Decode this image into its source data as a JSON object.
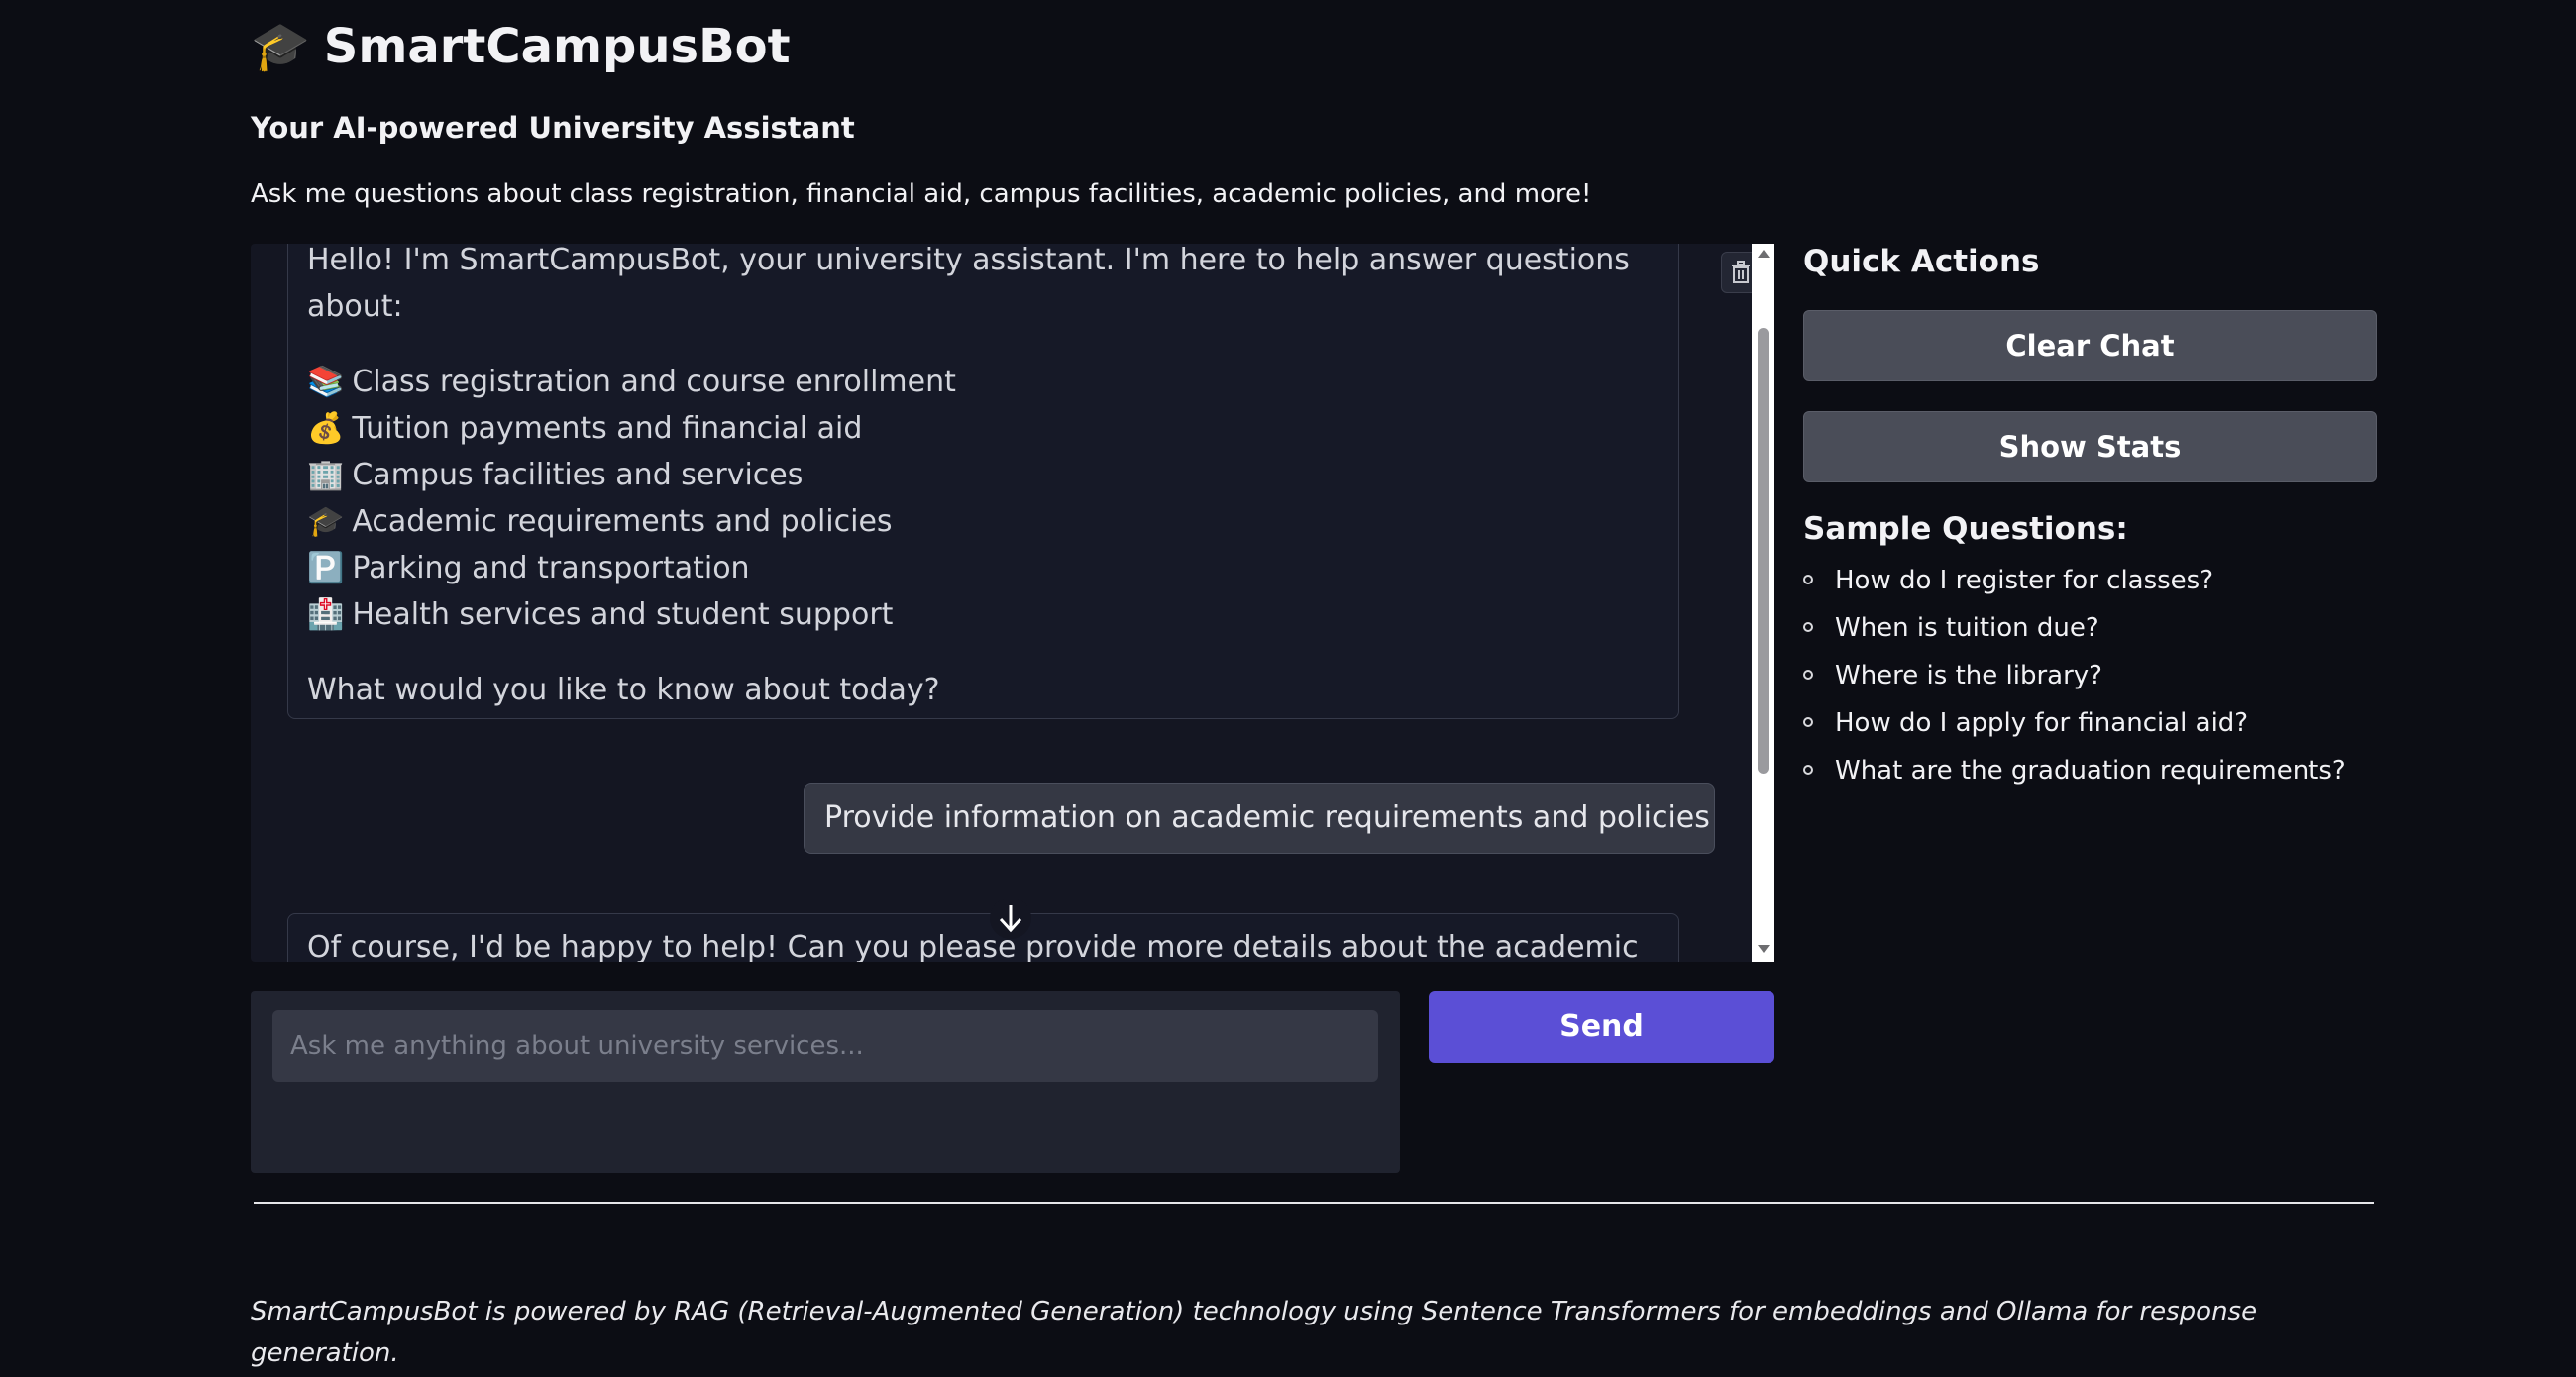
{
  "header": {
    "title_emoji": "🎓",
    "title": "SmartCampusBot",
    "subtitle": "Your AI-powered University Assistant",
    "intro": "Ask me questions about class registration, financial aid, campus facilities, academic policies, and more!"
  },
  "chat": {
    "bot_greeting_line1": "Hello! I'm SmartCampusBot, your university assistant. I'm here to help answer questions",
    "bot_greeting_line2": "about:",
    "topics": [
      {
        "icon": "📚",
        "label": "Class registration and course enrollment"
      },
      {
        "icon": "💰",
        "label": "Tuition payments and financial aid"
      },
      {
        "icon": "🏢",
        "label": "Campus facilities and services"
      },
      {
        "icon": "🎓",
        "label": "Academic requirements and policies"
      },
      {
        "icon": "🅿️",
        "label": "Parking and transportation"
      },
      {
        "icon": "🏥",
        "label": "Health services and student support"
      }
    ],
    "bot_greeting_closing": "What would you like to know about today?",
    "user_message": "Provide information on academic requirements and policies",
    "bot_reply": "Of course, I'd be happy to help! Can you please provide more details about the academic"
  },
  "input": {
    "placeholder": "Ask me anything about university services...",
    "send_label": "Send"
  },
  "sidebar": {
    "quick_actions_title": "Quick Actions",
    "clear_chat_label": "Clear Chat",
    "show_stats_label": "Show Stats",
    "sample_questions_title": "Sample Questions:",
    "sample_questions": [
      "How do I register for classes?",
      "When is tuition due?",
      "Where is the library?",
      "How do I apply for financial aid?",
      "What are the graduation requirements?"
    ]
  },
  "footer": {
    "text": "SmartCampusBot is powered by RAG (Retrieval-Augmented Generation) technology using Sentence Transformers for embeddings and Ollama for response generation."
  },
  "colors": {
    "background": "#0c0d14",
    "chat_panel": "#141622",
    "send_button": "#5b4fd6",
    "side_button": "#4a4d58"
  }
}
